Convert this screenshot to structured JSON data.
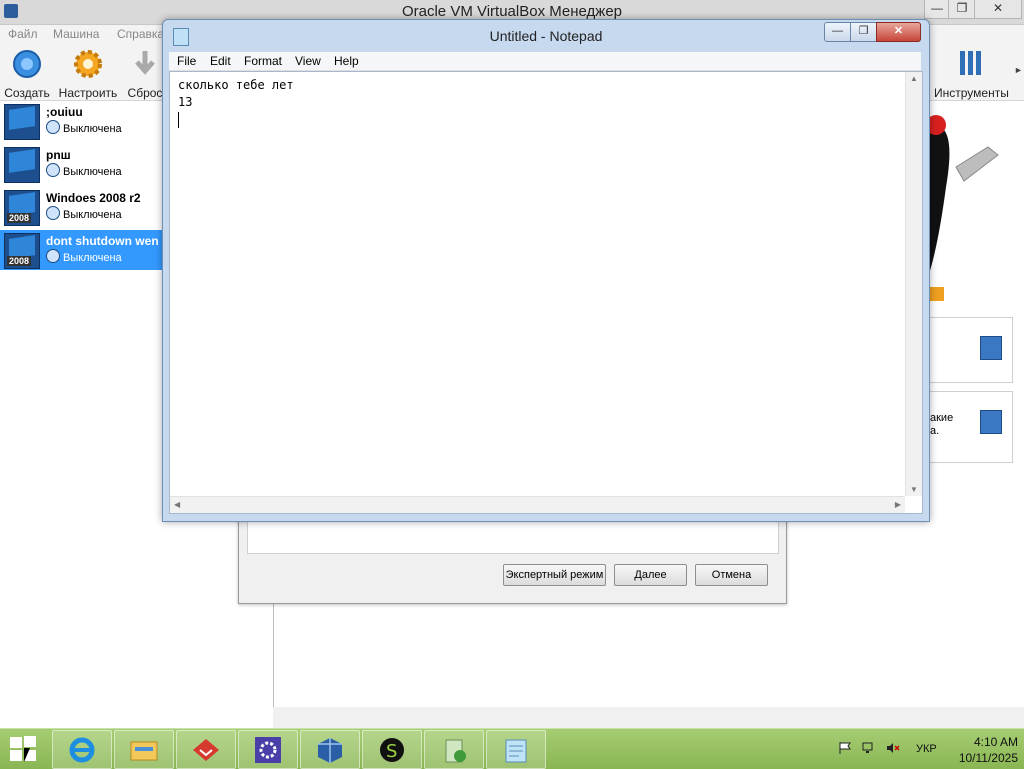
{
  "vbox": {
    "title": "Oracle VM VirtualBox Менеджер",
    "menu": [
      "Файл",
      "Машина",
      "Справка"
    ],
    "toolbar": {
      "create": "Создать",
      "settings": "Настроить",
      "discard": "Сброс",
      "tools": "Инструменты"
    },
    "vms": [
      {
        "name": ";ouiuu",
        "state": "Выключена",
        "year": ""
      },
      {
        "name": "pnш",
        "state": "Выключена",
        "year": ""
      },
      {
        "name": "Windoes 2008 r2",
        "state": "Выключена",
        "year": "2008"
      },
      {
        "name": "dont shutdown wen",
        "state": "Выключена",
        "year": "2008",
        "selected": true
      }
    ],
    "snapshot_text": "акие\nа."
  },
  "wizard": {
    "expert_label": "Экспертный режим",
    "next_label": "Далее",
    "cancel_label": "Отмена"
  },
  "notepad": {
    "title": "Untitled - Notepad",
    "menu": [
      "File",
      "Edit",
      "Format",
      "View",
      "Help"
    ],
    "content": "сколько тебе лет\n13"
  },
  "taskbar": {
    "apps": [
      "internet-explorer-icon",
      "file-explorer-icon",
      "red-app-icon",
      "settings-gear-icon",
      "virtualbox-icon",
      "s-green-icon",
      "recycle-app-icon",
      "notepad-icon"
    ],
    "language": "УКР",
    "time": "4:10 AM",
    "date": "10/11/2025"
  },
  "colors": {
    "selection": "#3399ff",
    "taskbar": "#89b653",
    "notepad_frame": "#c7d9ee",
    "close_red": "#c7453a"
  }
}
